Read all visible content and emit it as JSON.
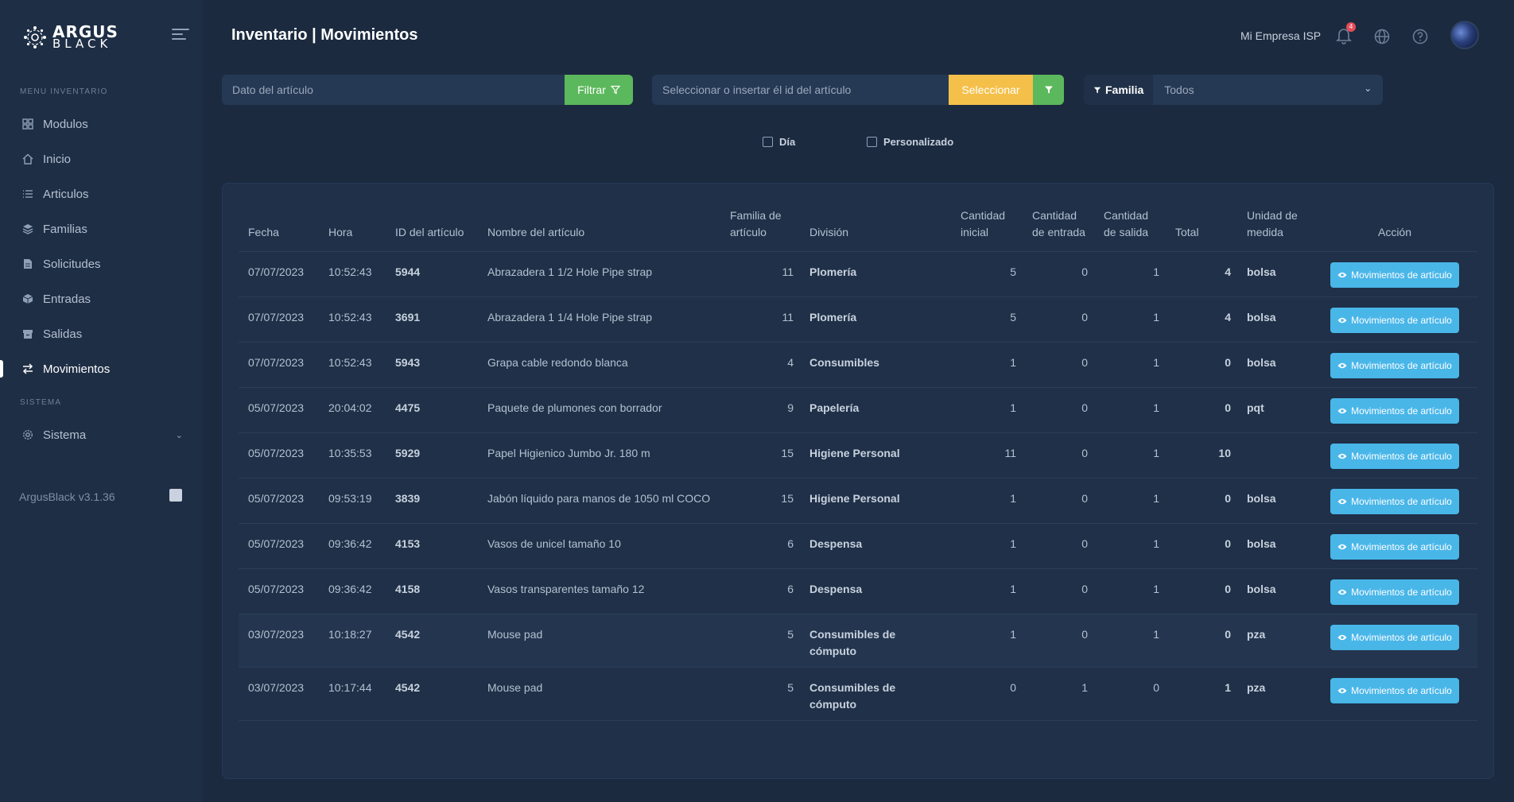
{
  "brand": {
    "line1": "ARGUS",
    "line2": "BLACK"
  },
  "sidebar": {
    "section_inventario": "MENU INVENTARIO",
    "section_sistema": "SISTEMA",
    "items": [
      {
        "label": "Modulos",
        "icon": "grid-icon"
      },
      {
        "label": "Inicio",
        "icon": "home-icon"
      },
      {
        "label": "Articulos",
        "icon": "list-icon"
      },
      {
        "label": "Familias",
        "icon": "layers-icon"
      },
      {
        "label": "Solicitudes",
        "icon": "document-icon"
      },
      {
        "label": "Entradas",
        "icon": "box-icon"
      },
      {
        "label": "Salidas",
        "icon": "archive-icon"
      },
      {
        "label": "Movimientos",
        "icon": "transfer-icon",
        "active": true
      }
    ],
    "sistema_label": "Sistema",
    "version": "ArgusBlack v3.1.36"
  },
  "header": {
    "title": "Inventario | Movimientos",
    "company": "Mi Empresa ISP",
    "notifications": "4"
  },
  "filters": {
    "article_placeholder": "Dato del artículo",
    "filter_label": "Filtrar",
    "id_placeholder": "Seleccionar o insertar él id del artículo",
    "select_label": "Seleccionar",
    "familia_label": "Familia",
    "familia_value": "Todos",
    "check_dia": "Día",
    "check_personalizado": "Personalizado"
  },
  "table": {
    "headers": {
      "fecha": "Fecha",
      "hora": "Hora",
      "id": "ID del artículo",
      "nombre": "Nombre del artículo",
      "familia": "Familia de artículo",
      "division": "División",
      "inicial": "Cantidad inicial",
      "entrada": "Cantidad de entrada",
      "salida": "Cantidad de salida",
      "total": "Total",
      "unidad": "Unidad de medida",
      "accion": "Acción"
    },
    "action_label": "Movimientos de artículo",
    "rows": [
      {
        "fecha": "07/07/2023",
        "hora": "10:52:43",
        "id": "5944",
        "nombre": "Abrazadera 1 1/2 Hole Pipe strap",
        "familia": "11",
        "division": "Plomería",
        "inicial": "5",
        "entrada": "0",
        "salida": "1",
        "total": "4",
        "unidad": "bolsa"
      },
      {
        "fecha": "07/07/2023",
        "hora": "10:52:43",
        "id": "3691",
        "nombre": "Abrazadera 1 1/4 Hole Pipe strap",
        "familia": "11",
        "division": "Plomería",
        "inicial": "5",
        "entrada": "0",
        "salida": "1",
        "total": "4",
        "unidad": "bolsa"
      },
      {
        "fecha": "07/07/2023",
        "hora": "10:52:43",
        "id": "5943",
        "nombre": "Grapa cable redondo blanca",
        "familia": "4",
        "division": "Consumibles",
        "inicial": "1",
        "entrada": "0",
        "salida": "1",
        "total": "0",
        "unidad": "bolsa"
      },
      {
        "fecha": "05/07/2023",
        "hora": "20:04:02",
        "id": "4475",
        "nombre": "Paquete de plumones con borrador",
        "familia": "9",
        "division": "Papelería",
        "inicial": "1",
        "entrada": "0",
        "salida": "1",
        "total": "0",
        "unidad": "pqt"
      },
      {
        "fecha": "05/07/2023",
        "hora": "10:35:53",
        "id": "5929",
        "nombre": "Papel Higienico Jumbo Jr. 180 m",
        "familia": "15",
        "division": "Higiene Personal",
        "inicial": "11",
        "entrada": "0",
        "salida": "1",
        "total": "10",
        "unidad": ""
      },
      {
        "fecha": "05/07/2023",
        "hora": "09:53:19",
        "id": "3839",
        "nombre": "Jabón líquido para manos de 1050 ml COCO",
        "familia": "15",
        "division": "Higiene Personal",
        "inicial": "1",
        "entrada": "0",
        "salida": "1",
        "total": "0",
        "unidad": "bolsa"
      },
      {
        "fecha": "05/07/2023",
        "hora": "09:36:42",
        "id": "4153",
        "nombre": "Vasos de unicel tamaño 10",
        "familia": "6",
        "division": "Despensa",
        "inicial": "1",
        "entrada": "0",
        "salida": "1",
        "total": "0",
        "unidad": "bolsa"
      },
      {
        "fecha": "05/07/2023",
        "hora": "09:36:42",
        "id": "4158",
        "nombre": "Vasos transparentes tamaño 12",
        "familia": "6",
        "division": "Despensa",
        "inicial": "1",
        "entrada": "0",
        "salida": "1",
        "total": "0",
        "unidad": "bolsa"
      },
      {
        "fecha": "03/07/2023",
        "hora": "10:18:27",
        "id": "4542",
        "nombre": "Mouse pad",
        "familia": "5",
        "division": "Consumibles de cómputo",
        "inicial": "1",
        "entrada": "0",
        "salida": "1",
        "total": "0",
        "unidad": "pza"
      },
      {
        "fecha": "03/07/2023",
        "hora": "10:17:44",
        "id": "4542",
        "nombre": "Mouse pad",
        "familia": "5",
        "division": "Consumibles de cómputo",
        "inicial": "0",
        "entrada": "1",
        "salida": "0",
        "total": "1",
        "unidad": "pza"
      }
    ]
  }
}
